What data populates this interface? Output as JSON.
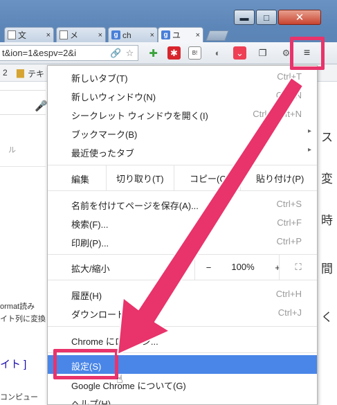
{
  "window": {
    "minimize_glyph": "▬",
    "maximize_glyph": "□",
    "close_glyph": "✕"
  },
  "tabs": [
    {
      "label": "文",
      "favicon": "page-icon",
      "close": "×"
    },
    {
      "label": "メ",
      "favicon": "page-icon",
      "close": "×"
    },
    {
      "label": "ch",
      "favicon": "google-icon",
      "favicon_text": "g",
      "close": "×"
    },
    {
      "label": "ユ",
      "favicon": "google-icon",
      "favicon_text": "g",
      "close": "×",
      "active": true
    }
  ],
  "toolbar": {
    "url": "t&ion=1&espv=2&i",
    "menu_icon": "hamburger-menu-icon",
    "menu_glyph": "≡"
  },
  "bookmarks": {
    "left_text": "2",
    "folder_label": "テキ"
  },
  "page": {
    "format_text": "ormat読み",
    "convert_text": "イト列に変換",
    "heading": "イト ]",
    "bottom_text": "コンピュー",
    "side_text": "ル",
    "right_chars": [
      "ス",
      "変",
      "時",
      "間",
      "く"
    ]
  },
  "menu": {
    "items_top": [
      {
        "label": "新しいタブ(T)",
        "shortcut": "Ctrl+T"
      },
      {
        "label": "新しいウィンドウ(N)",
        "shortcut": "Ctrl+N"
      },
      {
        "label": "シークレット ウィンドウを開く(I)",
        "shortcut": "Ctrl+Shift+N"
      },
      {
        "label": "ブックマーク(B)",
        "shortcut": "",
        "arrow": "▸"
      },
      {
        "label": "最近使ったタブ",
        "shortcut": "",
        "arrow": "▸"
      }
    ],
    "edit_row": {
      "label": "編集",
      "cut": "切り取り(T)",
      "copy": "コピー(C)",
      "paste": "貼り付け(P)"
    },
    "items_mid": [
      {
        "label": "名前を付けてページを保存(A)...",
        "shortcut": "Ctrl+S"
      },
      {
        "label": "検索(F)...",
        "shortcut": "Ctrl+F"
      },
      {
        "label": "印刷(P)...",
        "shortcut": "Ctrl+P"
      }
    ],
    "zoom_row": {
      "label": "拡大/縮小",
      "minus": "−",
      "value": "100%",
      "plus": "+",
      "fullscreen": "⛶"
    },
    "items_history": [
      {
        "label": "履歴(H)",
        "shortcut": "Ctrl+H"
      },
      {
        "label": "ダウンロード(D)",
        "shortcut": "Ctrl+J"
      }
    ],
    "signin": "Chrome にログイン...",
    "settings": "設定(S)",
    "about": "Google Chrome について(G)",
    "help": "ヘルプ(H)"
  },
  "colors": {
    "annotation": "#e8336b",
    "highlight": "#4a86e8",
    "titlebar": "#5d86b8"
  }
}
